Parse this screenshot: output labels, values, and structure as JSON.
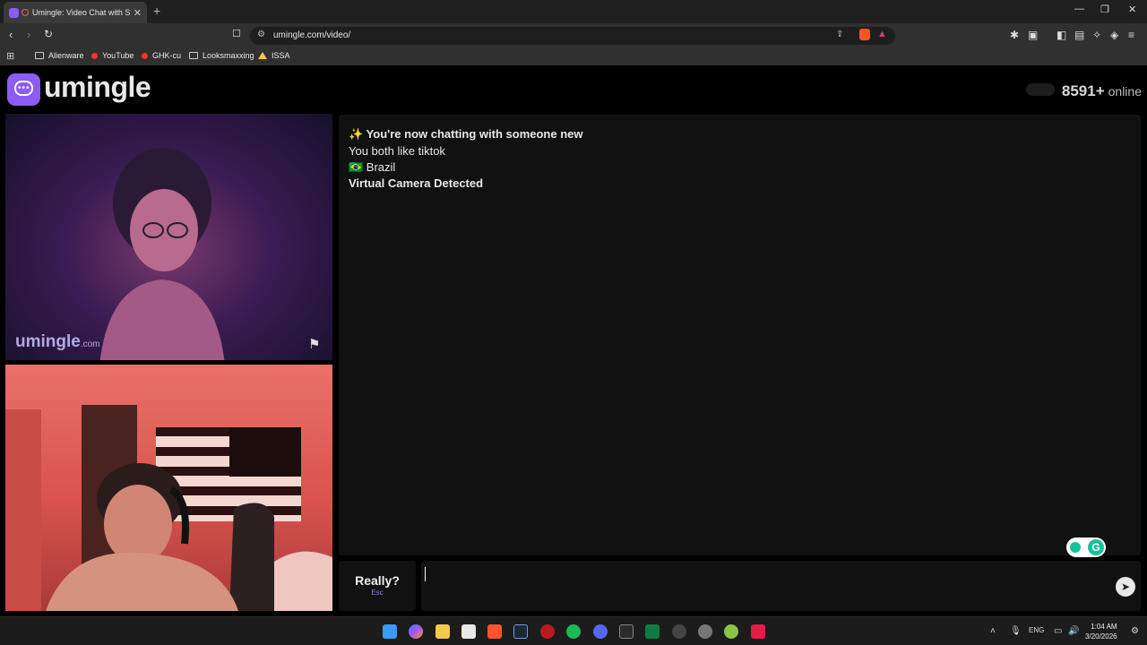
{
  "browser": {
    "tab_title": "Umingle: Video Chat with Strangers",
    "tab_close": "✕",
    "new_tab": "+",
    "url": "umingle.com/video/",
    "window_controls": [
      "—",
      "❐",
      "✕"
    ]
  },
  "bookmarks": [
    {
      "label": "Alienware",
      "icon": "folder-icon"
    },
    {
      "label": "YouTube",
      "icon": "youtube-icon"
    },
    {
      "label": "GHK-cu",
      "icon": "youtube-icon"
    },
    {
      "label": "Looksmaxxing",
      "icon": "folder-icon"
    },
    {
      "label": "ISSA",
      "icon": "triangle-icon"
    }
  ],
  "site": {
    "logo_text": "umingle",
    "online_count": "8591+",
    "online_label": "online",
    "watermark": "umingle",
    "watermark_suffix": ".com"
  },
  "chat": {
    "messages": [
      {
        "text": "✨ You're now chatting with someone new",
        "bold": true
      },
      {
        "text": "You both like tiktok",
        "bold": false
      },
      {
        "text": "🇧🇷 Brazil",
        "bold": false
      },
      {
        "text": "Virtual Camera Detected",
        "bold": true
      }
    ],
    "skip_label": "Really?",
    "skip_key": "Esc",
    "input_value": "",
    "send_icon": "send-icon"
  },
  "taskbar": {
    "tray_lang": "ENG",
    "time": "1:04 AM",
    "date": "3/20/2026"
  }
}
